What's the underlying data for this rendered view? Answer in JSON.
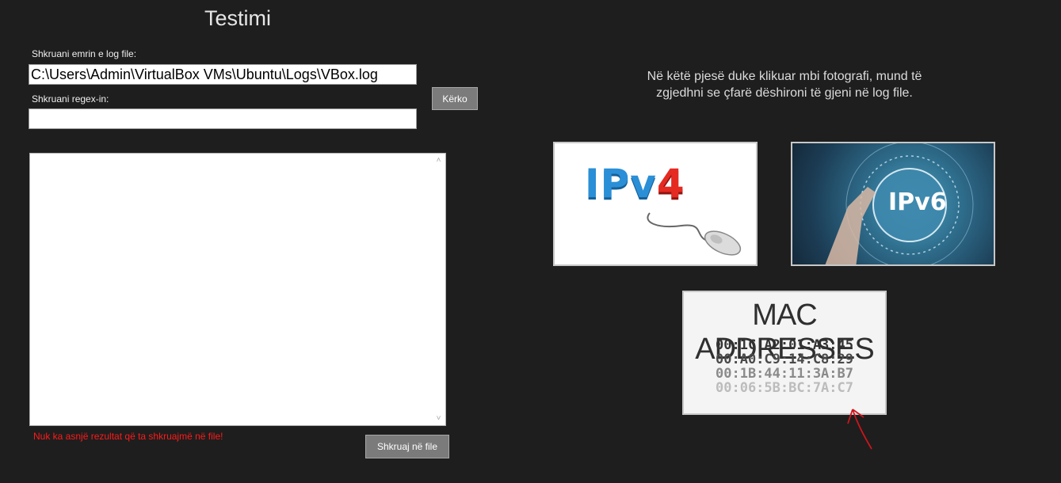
{
  "title": "Testimi",
  "log_file": {
    "label": "Shkruani emrin e log file:",
    "value": "C:\\Users\\Admin\\VirtualBox VMs\\Ubuntu\\Logs\\VBox.log"
  },
  "regex": {
    "label": "Shkruani regex-in:",
    "value": ""
  },
  "search_button": "Kërko",
  "results": {
    "content": ""
  },
  "error_message": "Nuk ka asnjë rezultat që ta shkruajmë në file!",
  "save_button": "Shkruaj në file",
  "info_text": {
    "line1": "Në këtë pjesë duke klikuar mbi fotografi, mund të",
    "line2": "zgjedhni se çfarë dëshironi të gjeni në log file."
  },
  "images": {
    "ipv4": {
      "word_main": "IPv",
      "word_accent": "4"
    },
    "ipv6": {
      "word": "IPv6"
    },
    "mac": {
      "title": "MAC ADDRESSES",
      "addresses": [
        "00:1C:A2:01:A3:45",
        "00:A0:C9:14:C8:29",
        "00:1B:44:11:3A:B7",
        "00:06:5B:BC:7A:C7"
      ]
    }
  },
  "colors": {
    "background": "#1e1e1e",
    "error": "#ff1a1a",
    "button": "#7b7b7b",
    "annotation_arrow": "#d0141b"
  }
}
